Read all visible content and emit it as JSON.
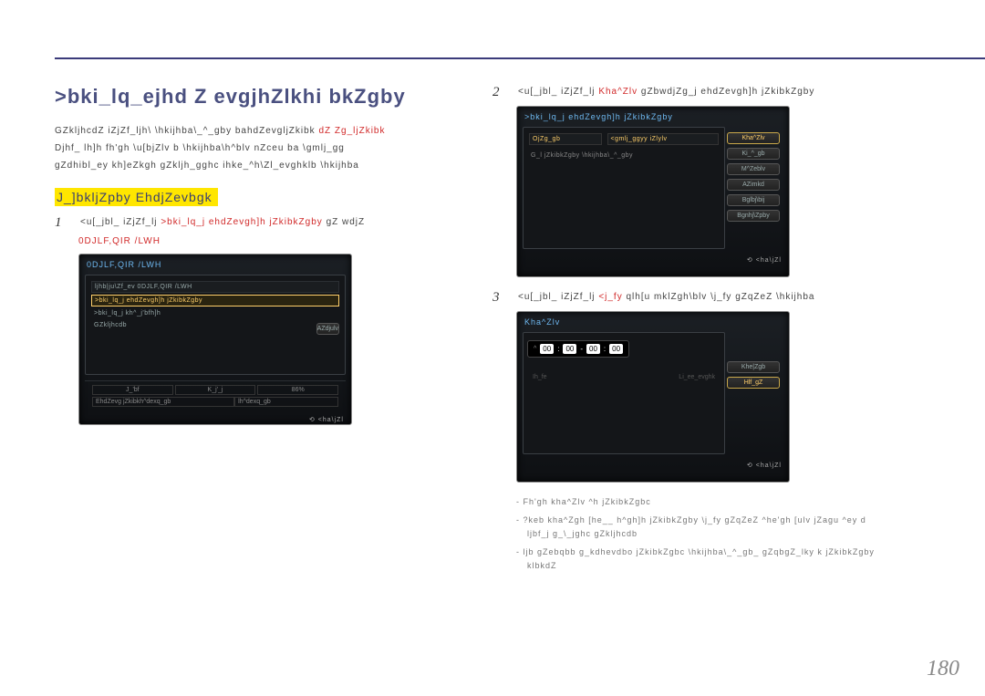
{
  "header": {
    "heading": ">bki_lq_ejhd Z evgjhZlkhi bkZgby"
  },
  "left": {
    "para1_a": "GZkljhcdZ iZjZf_ljh\\ \\hkijhba\\_^_gby bahdZevgljZkibk",
    "para1_red": "dZ Zg_ljZkibk",
    "para2": "Djhf_ lh]h  fh'gh \\u[bjZlv b \\hkijhba\\h^blv nZceu ba \\gmlj_gg",
    "para3": "gZdhibl_ey  kh]eZkgh gZkljh_gghc ihke_^h\\Zl_evghklb \\hkijhba",
    "subhead": "J_]bkljZpby EhdjZevbgk",
    "step1": {
      "num": "1",
      "text_a": "<u[_jbl_ iZjZf_lj ",
      "text_red": ">bki_lq_j ehdZevgh]h jZkibkZgby",
      "text_b": " gZ wdjZ",
      "red_line": "0DJLF,QIR /LWH"
    },
    "shot1": {
      "title": "0DJLF,QIR /LWH",
      "row1": "ljhb|ju\\Zf_ev 0DJLF,QIR /LWH",
      "row2": ">bki_lq_j ehdZevgh]h jZkibkZgby",
      "row3": ">bki_lq_j kh^_j'bfh]h",
      "row4": "GZkljhcdb",
      "btn1": "AZdjulv",
      "foot_a": "J_'bf",
      "foot_b": "K_j'_j",
      "foot_c": "86%",
      "foot2": "EhdZevg jZkibkh^dexq_gb",
      "foot2_r": "lh^dexq_gb",
      "back": "<ha\\jZl"
    }
  },
  "right": {
    "step2": {
      "num": "2",
      "text_a": "<u[_jbl_ iZjZf_lj ",
      "text_red": "Kha^Zlv",
      "text_b": " gZbwdjZg_j ehdZevgh]h jZkibkZgby"
    },
    "shot2": {
      "title": ">bki_lq_j ehdZevgh]h jZkibkZgby",
      "col_a": "OjZg_gb",
      "col_b": "<gmlj_ggyy iZlylv",
      "hint": "G_l jZkibkZgby \\hkijhba\\_^_gby",
      "r1": "Kha^Zlv",
      "r2": "Ki_^_gb",
      "r3": "M^Zeblv",
      "r4": "AZimkd",
      "r5": "Bglbj\\bij",
      "r6": "Bgnhj\\Zpby",
      "back": "<ha\\jZl"
    },
    "step3": {
      "num": "3",
      "text_a": "<u[_jbl_ iZjZf_lj ",
      "text_red": "<j_fy",
      "text_b": "  qlh[u mklZgh\\blv \\j_fy gZqZeZ \\hkijhba"
    },
    "shot3": {
      "title": "Kha^Zlv",
      "t1": "00",
      "t2": "00",
      "t3": "00",
      "t4": "00",
      "h1": "Ih_fe",
      "h2": "Li_ee_evghk",
      "r1": "Khe|Zgb",
      "r2": "Hlf_gZ",
      "back": "<ha\\jZl"
    },
    "notes": {
      "n1": "- Fh'gh kha^Zlv ^h    jZkibkZgbc",
      "n2": "- ?keb kha^Zgh [he__ h^gh]h jZkibkZgby  \\j_fy gZqZeZ ^he'gh [ulv jZagu ^ey d",
      "n2b": "ljbf_j g_\\_jghc gZkljhcdb",
      "n3": "- ljb gZebqbb g_kdhevdbo jZkibkZgbc \\hkijhba\\_^_gb_ gZqbgZ_lky k jZkibkZgby",
      "n3b": "klbkdZ"
    }
  },
  "page": "180"
}
